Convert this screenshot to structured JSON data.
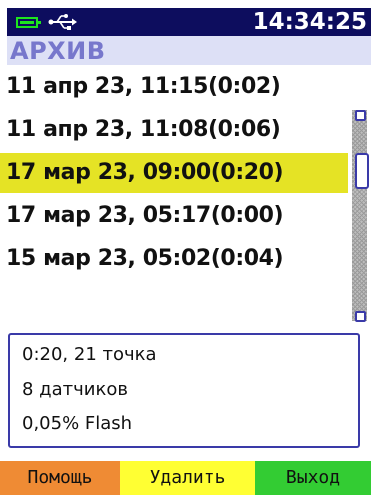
{
  "status": {
    "battery_icon": "battery-icon",
    "usb_icon": "usb-icon",
    "clock": "14:34:25",
    "colors": {
      "bar": "#0d0d5e",
      "battery": "#1de41d"
    }
  },
  "title": "АРХИВ",
  "archive": {
    "items": [
      {
        "label": "11 апр 23, 11:15(0:02)",
        "selected": false
      },
      {
        "label": "11 апр 23, 11:08(0:06)",
        "selected": false
      },
      {
        "label": "17 мар 23, 09:00(0:20)",
        "selected": true
      },
      {
        "label": "17 мар 23, 05:17(0:00)",
        "selected": false
      },
      {
        "label": "15 мар 23, 05:02(0:04)",
        "selected": false
      }
    ],
    "selection_color": "#e5e325"
  },
  "details": {
    "line1": "0:20, 21 точка",
    "line2": "8 датчиков",
    "line3": "0,05% Flash"
  },
  "softkeys": {
    "help": "Помощь",
    "delete": "Удалить",
    "exit": "Выход",
    "colors": {
      "help": "#ef8b34",
      "delete": "#ffff33",
      "exit": "#33cc33"
    }
  }
}
